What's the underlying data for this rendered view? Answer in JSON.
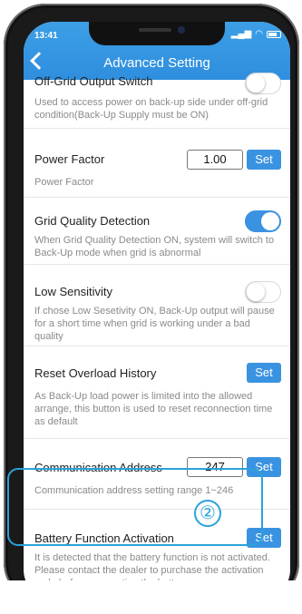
{
  "status": {
    "time": "13:41",
    "signal": "signal-bars-icon",
    "wifi": "wifi-icon",
    "battery": "battery-icon"
  },
  "header": {
    "title": "Advanced Setting",
    "back_icon": "chevron-left-icon",
    "color": "#3a93e1"
  },
  "rows": {
    "offgrid": {
      "label": "Off-Grid Output Switch",
      "desc": "Used to access power on back-up side under off-grid condition(Back-Up Supply must be ON)",
      "state": "off"
    },
    "power_factor": {
      "label": "Power Factor",
      "value": "1.00",
      "button": "Set",
      "desc": "Power Factor"
    },
    "grid_quality": {
      "label": "Grid Quality Detection",
      "desc": "When Grid Quality Detection ON, system will switch to Back-Up mode when grid is abnormal",
      "state": "on"
    },
    "low_sensitivity": {
      "label": "Low Sensitivity",
      "desc": "If chose Low Sesetivity ON, Back-Up output will pause for a short time when grid is working under a bad quality",
      "state": "off"
    },
    "reset_overload": {
      "label": "Reset Overload History",
      "button": "Set",
      "desc": "As Back-Up load power is limited into the allowed arrange, this button is used to reset reconnection time as default"
    },
    "comm_address": {
      "label": "Communication Address",
      "value": "247",
      "button": "Set",
      "desc": "Communication address setting range 1~246"
    },
    "battery_activation": {
      "label": "Battery Function Activation",
      "button": "Set",
      "desc": "It is detected that the battery function is not activated. Please contact the dealer to purchase the activation code before connecting the battery"
    }
  },
  "annotation": {
    "marker": "②",
    "color": "#2aa3d9"
  }
}
